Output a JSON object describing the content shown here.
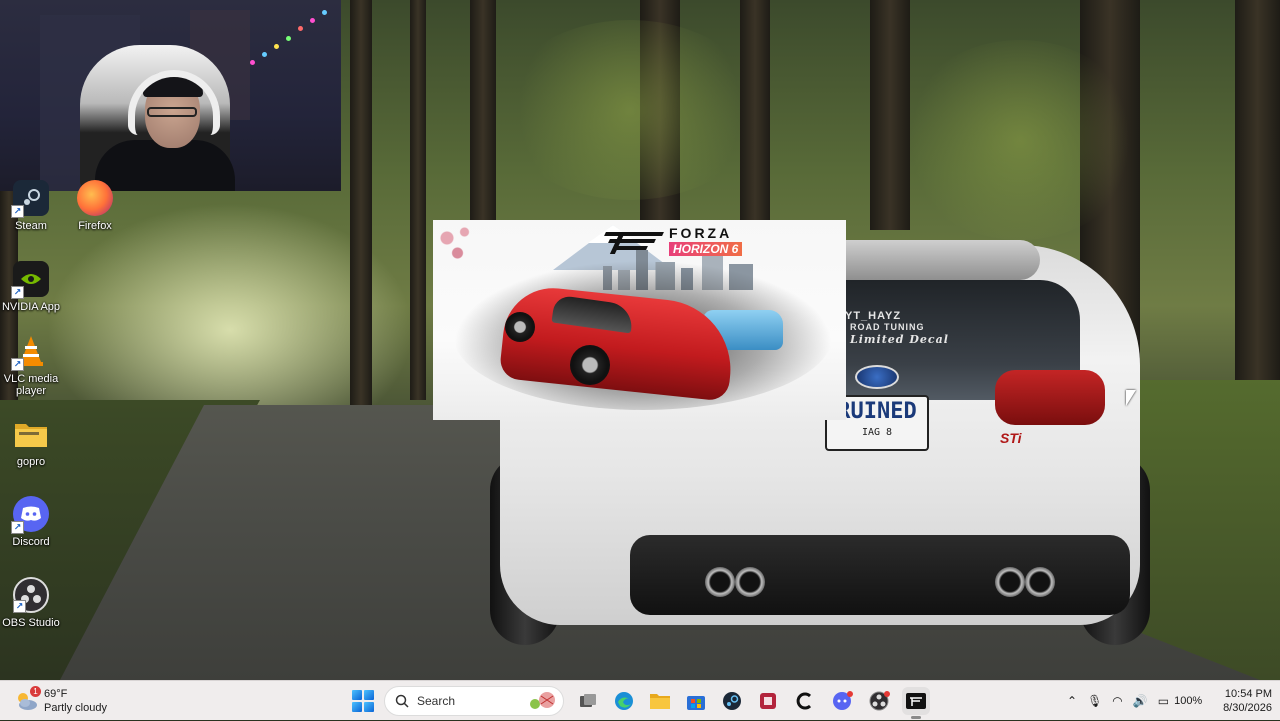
{
  "desktop": {
    "icons": [
      {
        "label": "Steam",
        "icon": "steam-icon",
        "color": "#1b2838"
      },
      {
        "label": "Firefox",
        "icon": "firefox-icon",
        "color": "#ff7139"
      },
      {
        "label": "NVIDIA App",
        "icon": "nvidia-icon",
        "color": "#76b900"
      },
      {
        "label": "VLC media player",
        "icon": "vlc-icon",
        "color": "#f48b00"
      },
      {
        "label": "gopro",
        "icon": "folder-icon",
        "color": "#f2c23a"
      },
      {
        "label": "Discord",
        "icon": "discord-icon",
        "color": "#5865f2"
      },
      {
        "label": "OBS Studio",
        "icon": "obs-icon",
        "color": "#302e31"
      }
    ]
  },
  "wallpaper": {
    "window_sticker": "YT_HAYZ",
    "window_sticker_2": "ROAD TUNING",
    "window_sticker_3": "Limited Decal",
    "plate": "RUINED",
    "plate_sub": "IAG 8",
    "badge": "STi"
  },
  "game_window": {
    "brand": "FORZA",
    "subtitle": "HORIZON 6"
  },
  "taskbar": {
    "weather": {
      "temp": "69°F",
      "condition": "Partly cloudy",
      "alert_count": "1"
    },
    "search_label": "Search",
    "apps": [
      {
        "name": "file-explorer-button",
        "icon": "folder-icon"
      },
      {
        "name": "edge-button",
        "icon": "edge-icon"
      },
      {
        "name": "microsoft-store-button",
        "icon": "store-icon"
      },
      {
        "name": "steam-taskbar-button",
        "icon": "steam-icon"
      },
      {
        "name": "app-red-button",
        "icon": "app-icon"
      },
      {
        "name": "capcut-button",
        "icon": "capcut-icon"
      },
      {
        "name": "discord-taskbar-button",
        "icon": "discord-icon"
      },
      {
        "name": "obs-taskbar-button",
        "icon": "obs-icon"
      },
      {
        "name": "forza-taskbar-button",
        "icon": "forza-icon"
      }
    ],
    "tray": {
      "battery": "100%",
      "time": "10:54 PM",
      "date": "8/30/2026"
    }
  }
}
